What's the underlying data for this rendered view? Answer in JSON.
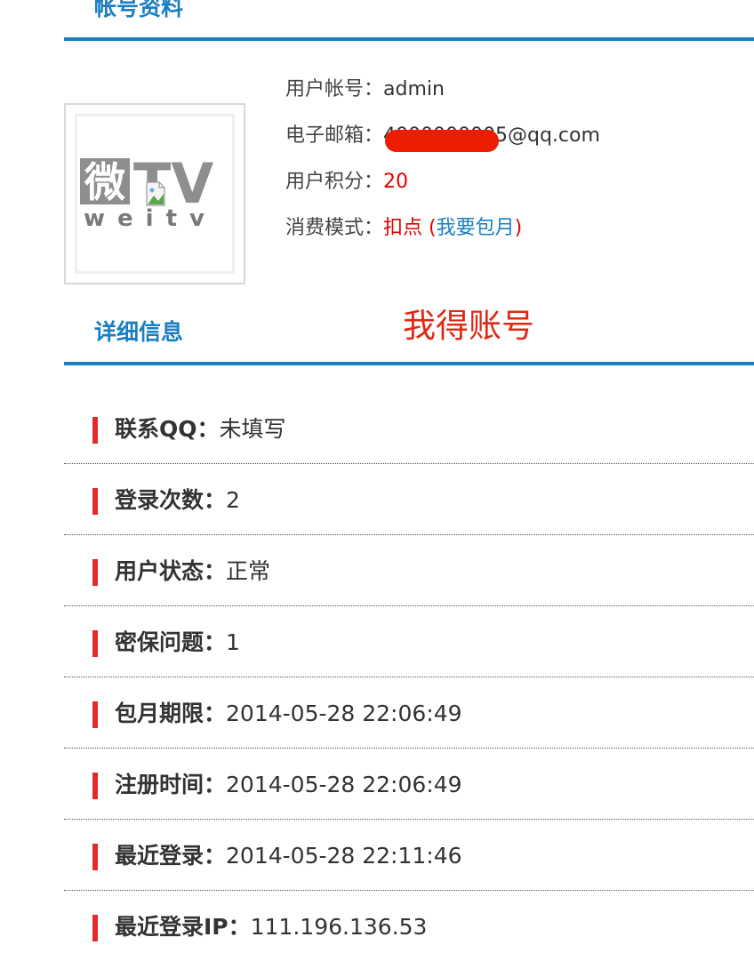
{
  "account": {
    "title": "帐号资料",
    "username_label": "用户帐号：",
    "username_value": "admin",
    "email_label": "电子邮箱：",
    "email_value": "4000000005@qq.com",
    "points_label": "用户积分：",
    "points_value": "20",
    "mode_label": "消费模式：",
    "mode_value": "扣点",
    "mode_paren_open": " (",
    "mode_link": "我要包月",
    "mode_paren_close": ")"
  },
  "avatar": {
    "logo_main": "微TV",
    "logo_sub": "weitv"
  },
  "annotation": "我得账号",
  "details": {
    "title": "详细信息",
    "rows": [
      {
        "label": "联系QQ：",
        "value": "未填写"
      },
      {
        "label": "登录次数：",
        "value": "2"
      },
      {
        "label": "用户状态：",
        "value": "正常"
      },
      {
        "label": "密保问题：",
        "value": "1"
      },
      {
        "label": "包月期限：",
        "value": "2014-05-28 22:06:49"
      },
      {
        "label": "注册时间：",
        "value": "2014-05-28 22:06:49"
      },
      {
        "label": "最近登录：",
        "value": "2014-05-28 22:11:46"
      },
      {
        "label": "最近登录IP：",
        "value": "111.196.136.53"
      }
    ]
  },
  "colors": {
    "accent_blue": "#1a7fc1",
    "highlight_red": "#e00000",
    "bar_red": "#e22a2a",
    "annotation_red": "#e02814"
  }
}
